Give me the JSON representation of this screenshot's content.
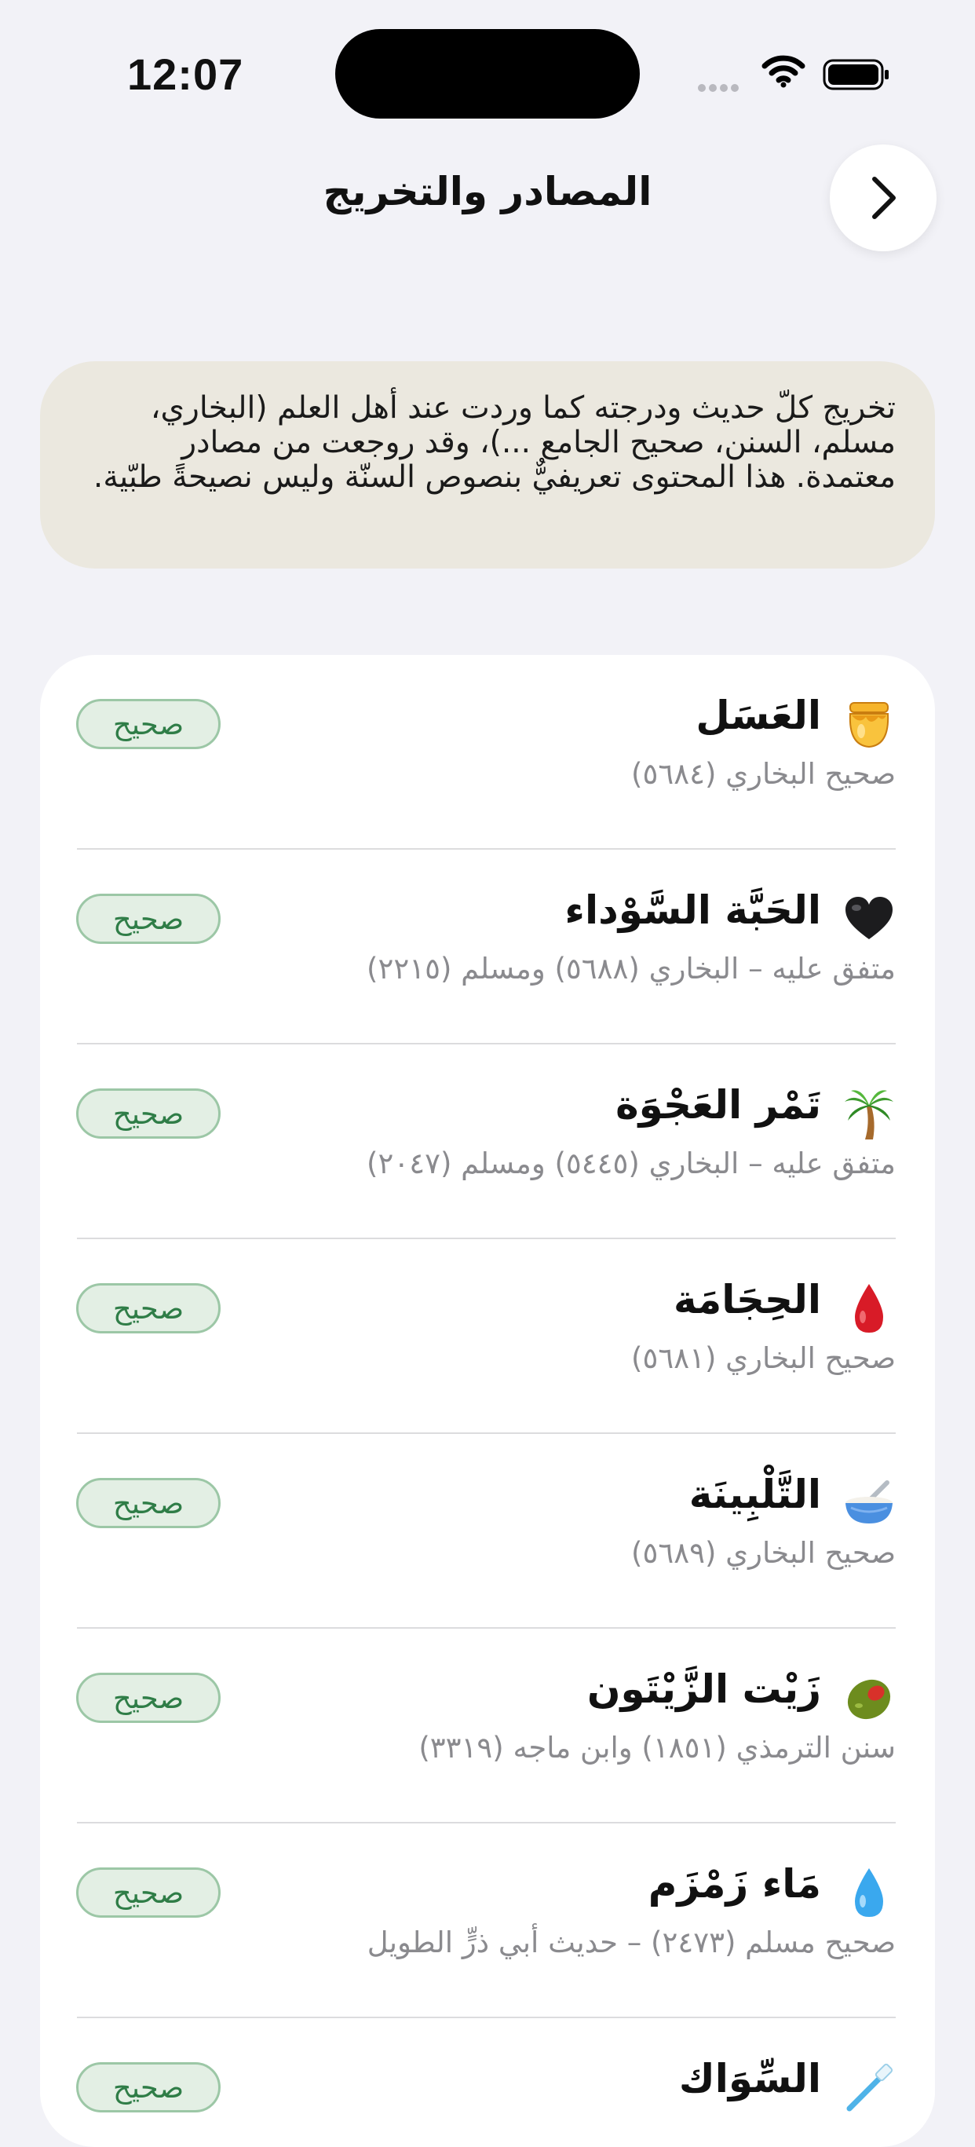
{
  "status_bar": {
    "time": "12:07"
  },
  "nav": {
    "title": "المصادر والتخريج"
  },
  "disclaimer": {
    "text": "تخريج كلّ حديث ودرجته كما وردت عند أهل العلم (البخاري، مسلم، السنن، صحيح الجامع ...)، وقد روجعت من مصادر معتمدة. هذا المحتوى تعريفيٌّ بنصوص السنّة وليس نصيحةً طبّية."
  },
  "sources": [
    {
      "icon": "honey-pot-icon",
      "title": "العَسَل",
      "source": "صحيح البخاري (٥٦٨٤)",
      "grade": "صحيح"
    },
    {
      "icon": "black-heart-icon",
      "title": "الحَبَّة السَّوْداء",
      "source": "متفق عليه – البخاري (٥٦٨٨) ومسلم (٢٢١٥)",
      "grade": "صحيح"
    },
    {
      "icon": "palm-tree-icon",
      "title": "تَمْر العَجْوَة",
      "source": "متفق عليه – البخاري (٥٤٤٥) ومسلم (٢٠٤٧)",
      "grade": "صحيح"
    },
    {
      "icon": "blood-drop-icon",
      "title": "الحِجَامَة",
      "source": "صحيح البخاري (٥٦٨١)",
      "grade": "صحيح"
    },
    {
      "icon": "bowl-spoon-icon",
      "title": "التَّلْبِينَة",
      "source": "صحيح البخاري (٥٦٨٩)",
      "grade": "صحيح"
    },
    {
      "icon": "olive-icon",
      "title": "زَيْت الزَّيْتَون",
      "source": "سنن الترمذي (١٨٥١) وابن ماجه (٣٣١٩)",
      "grade": "صحيح"
    },
    {
      "icon": "water-drop-icon",
      "title": "مَاء زَمْزَم",
      "source": "صحيح مسلم (٢٤٧٣) – حديث أبي ذرٍّ الطويل",
      "grade": "صحيح"
    },
    {
      "icon": "toothbrush-icon",
      "title": "السِّوَاك",
      "source": "",
      "grade": "صحيح"
    }
  ]
}
